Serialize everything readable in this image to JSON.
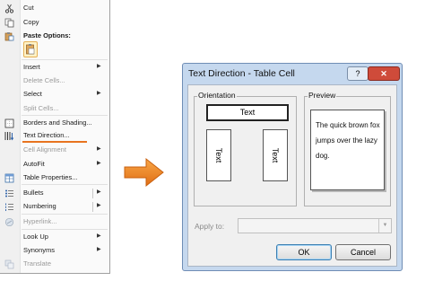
{
  "context_menu": {
    "cut": "Cut",
    "copy": "Copy",
    "paste_options": "Paste Options:",
    "insert": "Insert",
    "delete_cells": "Delete Cells...",
    "select": "Select",
    "split_cells": "Split Cells...",
    "borders_and_shading": "Borders and Shading...",
    "text_direction": "Text Direction...",
    "cell_alignment": "Cell Alignment",
    "autofit": "AutoFit",
    "table_properties": "Table Properties...",
    "bullets": "Bullets",
    "numbering": "Numbering",
    "hyperlink": "Hyperlink...",
    "look_up": "Look Up",
    "synonyms": "Synonyms",
    "translate": "Translate",
    "submenu_arrow": "▶"
  },
  "dialog": {
    "title": "Text Direction - Table Cell",
    "help_button": "?",
    "close_button": "✕",
    "orientation_label": "Orientation",
    "orientation_option_text": "Text",
    "preview_label": "Preview",
    "preview_text": "The quick brown fox jumps over the lazy dog.",
    "apply_to_label": "Apply to:",
    "apply_to_value": "",
    "ok_label": "OK",
    "cancel_label": "Cancel"
  },
  "colors": {
    "highlight_underline": "#e8741f",
    "arrow": "#f08a24",
    "dialog_frame": "#c5d8ee",
    "close_button": "#cf4b3a"
  },
  "icons": [
    "scissors-icon",
    "copy-icon",
    "paste-icon",
    "paste-keep-formatting-icon",
    "borders-icon",
    "text-direction-icon",
    "table-properties-icon",
    "bullets-icon",
    "numbering-icon",
    "hyperlink-icon",
    "translate-icon",
    "arrow-right-icon"
  ]
}
